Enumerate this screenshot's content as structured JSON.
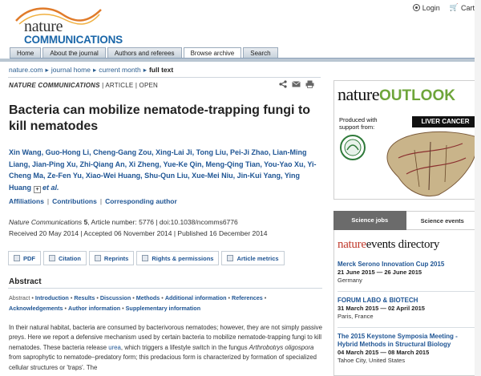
{
  "header": {
    "logo_top": "nature",
    "logo_bottom": "COMMUNICATIONS",
    "login": "Login",
    "cart": "Cart"
  },
  "nav": {
    "tabs": [
      {
        "label": "Home"
      },
      {
        "label": "About the journal"
      },
      {
        "label": "Authors and referees"
      },
      {
        "label": "Browse archive"
      },
      {
        "label": "Search"
      }
    ]
  },
  "breadcrumb": {
    "items": [
      "nature.com",
      "journal home",
      "current month"
    ],
    "current": "full text"
  },
  "article": {
    "journal": "NATURE COMMUNICATIONS",
    "type": "ARTICLE",
    "open": "OPEN",
    "title": "Bacteria can mobilize nematode-trapping fungi to kill nematodes",
    "authors": "Xin Wang, Guo-Hong Li, Cheng-Gang Zou, Xing-Lai Ji, Tong Liu, Pei-Ji Zhao, Lian-Ming Liang, Jian-Ping Xu, Zhi-Qiang An, Xi Zheng, Yue-Ke Qin, Meng-Qing Tian, You-Yao Xu, Yi-Cheng Ma, Ze-Fen Yu, Xiao-Wei Huang, Shu-Qun Liu, Xue-Mei Niu, Jin-Kui Yang, Ying Huang",
    "etal": "et al.",
    "links": [
      "Affiliations",
      "Contributions",
      "Corresponding author"
    ],
    "citation_journal": "Nature Communications",
    "volume": "5",
    "article_number": ", Article number: 5776",
    "doi": "doi:10.1038/ncomms6776",
    "dates": "Received 20 May 2014 | Accepted 06 November 2014 | Published 16 December 2014"
  },
  "tools": [
    {
      "label": "PDF",
      "icon": "pdf-icon"
    },
    {
      "label": "Citation",
      "icon": "citation-icon"
    },
    {
      "label": "Reprints",
      "icon": "reprints-icon"
    },
    {
      "label": "Rights & permissions",
      "icon": "rights-icon"
    },
    {
      "label": "Article metrics",
      "icon": "metrics-icon"
    }
  ],
  "abstract": {
    "heading": "Abstract",
    "toc_label": "Abstract",
    "toc_items": [
      "Introduction",
      "Results",
      "Discussion",
      "Methods",
      "Additional information",
      "References",
      "Acknowledgements",
      "Author information",
      "Supplementary information"
    ],
    "text_part1": "In their natural habitat, bacteria are consumed by bacterivorous nematodes; however, they are not simply passive preys. Here we report a defensive mechanism used by certain bacteria to mobilize nematode-trapping fungi to kill nematodes. These bacteria release ",
    "text_link": "urea",
    "text_part2": ", which triggers a lifestyle switch in the fungus ",
    "text_species": "Arthrobotrys oligospora",
    "text_part3": " from saprophytic to nematode–predatory form; this predacious form is characterized by formation of specialized cellular structures or 'traps'. The"
  },
  "ad": {
    "brand_a": "nature",
    "brand_b": "OUTLOOK",
    "produced": "Produced with",
    "support": "support from:",
    "banner": "LIVER CANCER"
  },
  "jobs": {
    "tab1": "Science jobs",
    "tab2": "Science events"
  },
  "events": {
    "head_a": "nature",
    "head_b": "events directory",
    "items": [
      {
        "title": "Merck Serono Innovation Cup 2015",
        "date": "21 June 2015 — 26 June 2015",
        "place": "Germany"
      },
      {
        "title": "FORUM LABO & BIOTECH",
        "date": "31 March 2015 — 02 April 2015",
        "place": "Paris, France"
      },
      {
        "title": "The 2015 Keystone Symposia Meeting - Hybrid Methods in Structural Biology",
        "date": "04 March 2015 — 08 March 2015",
        "place": "Tahoe City, United States"
      }
    ]
  },
  "colors": {
    "link": "#1f5594",
    "brand_green": "#6ea53a",
    "brand_blue": "#1a66a8"
  }
}
